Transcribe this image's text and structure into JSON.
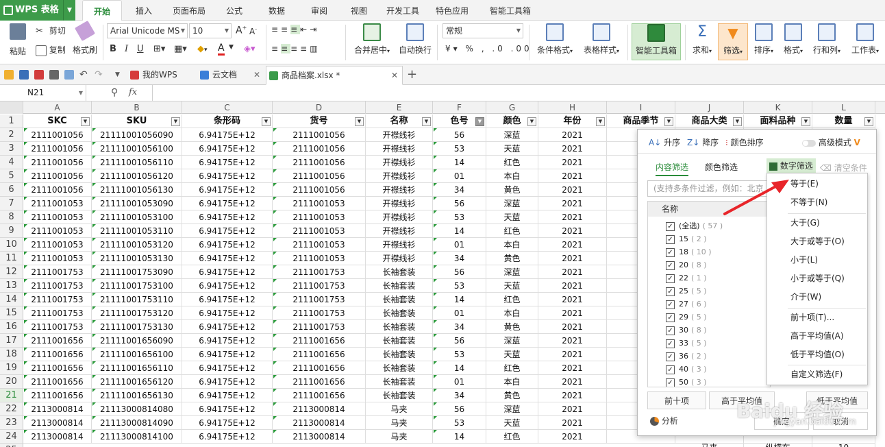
{
  "menubar": {
    "app_button": "WPS 表格",
    "tabs": [
      "开始",
      "插入",
      "页面布局",
      "公式",
      "数据",
      "审阅",
      "视图",
      "开发工具",
      "特色应用",
      "智能工具箱"
    ],
    "active_tab": "开始"
  },
  "ribbon": {
    "paste": "粘贴",
    "cut": "剪切",
    "copy": "复制",
    "format_painter": "格式刷",
    "font_name": "Arial Unicode MS",
    "font_size": "10",
    "number_format": "常规",
    "merge_center": "合并居中",
    "wrap_text": "自动换行",
    "cond_format": "条件格式",
    "table_style": "表格样式",
    "smart_toolbox": "智能工具箱",
    "sum": "求和",
    "filter": "筛选",
    "sort": "排序",
    "format": "格式",
    "row_col": "行和列",
    "worksheet": "工作表"
  },
  "doc_tabs": [
    {
      "label": "我的WPS"
    },
    {
      "label": "云文档"
    },
    {
      "label": "商品档案.xlsx *"
    }
  ],
  "formula_bar": {
    "cell_ref": "N21",
    "fx": "fx"
  },
  "sheet": {
    "columns": [
      "A",
      "B",
      "C",
      "D",
      "E",
      "F",
      "G",
      "H",
      "I",
      "J",
      "K",
      "L"
    ],
    "headers": [
      "SKC",
      "SKU",
      "条形码",
      "货号",
      "名称",
      "色号",
      "颜色",
      "年份",
      "商品季节",
      "商品大类",
      "面料品种",
      "数量"
    ],
    "rows": [
      [
        "2111001056",
        "21111001056090",
        "6.94175E+12",
        "2111001056",
        "开襟线衫",
        "56",
        "深蓝",
        "2021"
      ],
      [
        "2111001056",
        "21111001056100",
        "6.94175E+12",
        "2111001056",
        "开襟线衫",
        "53",
        "天蓝",
        "2021"
      ],
      [
        "2111001056",
        "21111001056110",
        "6.94175E+12",
        "2111001056",
        "开襟线衫",
        "14",
        "红色",
        "2021"
      ],
      [
        "2111001056",
        "21111001056120",
        "6.94175E+12",
        "2111001056",
        "开襟线衫",
        "01",
        "本白",
        "2021"
      ],
      [
        "2111001056",
        "21111001056130",
        "6.94175E+12",
        "2111001056",
        "开襟线衫",
        "34",
        "黄色",
        "2021"
      ],
      [
        "2111001053",
        "21111001053090",
        "6.94175E+12",
        "2111001053",
        "开襟线衫",
        "56",
        "深蓝",
        "2021"
      ],
      [
        "2111001053",
        "21111001053100",
        "6.94175E+12",
        "2111001053",
        "开襟线衫",
        "53",
        "天蓝",
        "2021"
      ],
      [
        "2111001053",
        "21111001053110",
        "6.94175E+12",
        "2111001053",
        "开襟线衫",
        "14",
        "红色",
        "2021"
      ],
      [
        "2111001053",
        "21111001053120",
        "6.94175E+12",
        "2111001053",
        "开襟线衫",
        "01",
        "本白",
        "2021"
      ],
      [
        "2111001053",
        "21111001053130",
        "6.94175E+12",
        "2111001053",
        "开襟线衫",
        "34",
        "黄色",
        "2021"
      ],
      [
        "2111001753",
        "21111001753090",
        "6.94175E+12",
        "2111001753",
        "长袖套装",
        "56",
        "深蓝",
        "2021"
      ],
      [
        "2111001753",
        "21111001753100",
        "6.94175E+12",
        "2111001753",
        "长袖套装",
        "53",
        "天蓝",
        "2021"
      ],
      [
        "2111001753",
        "21111001753110",
        "6.94175E+12",
        "2111001753",
        "长袖套装",
        "14",
        "红色",
        "2021"
      ],
      [
        "2111001753",
        "21111001753120",
        "6.94175E+12",
        "2111001753",
        "长袖套装",
        "01",
        "本白",
        "2021"
      ],
      [
        "2111001753",
        "21111001753130",
        "6.94175E+12",
        "2111001753",
        "长袖套装",
        "34",
        "黄色",
        "2021"
      ],
      [
        "2111001656",
        "21111001656090",
        "6.94175E+12",
        "2111001656",
        "长袖套装",
        "56",
        "深蓝",
        "2021"
      ],
      [
        "2111001656",
        "21111001656100",
        "6.94175E+12",
        "2111001656",
        "长袖套装",
        "53",
        "天蓝",
        "2021"
      ],
      [
        "2111001656",
        "21111001656110",
        "6.94175E+12",
        "2111001656",
        "长袖套装",
        "14",
        "红色",
        "2021"
      ],
      [
        "2111001656",
        "21111001656120",
        "6.94175E+12",
        "2111001656",
        "长袖套装",
        "01",
        "本白",
        "2021"
      ],
      [
        "2111001656",
        "21111001656130",
        "6.94175E+12",
        "2111001656",
        "长袖套装",
        "34",
        "黄色",
        "2021"
      ],
      [
        "2113000814",
        "21113000814080",
        "6.94175E+12",
        "2113000814",
        "马夹",
        "56",
        "深蓝",
        "2021"
      ],
      [
        "2113000814",
        "21113000814090",
        "6.94175E+12",
        "2113000814",
        "马夹",
        "53",
        "天蓝",
        "2021"
      ],
      [
        "2113000814",
        "21113000814100",
        "6.94175E+12",
        "2113000814",
        "马夹",
        "14",
        "红色",
        "2021"
      ]
    ],
    "selected_row": "21",
    "partial_row_behind_panel": {
      "J": "马夹",
      "K": "纵横布",
      "L": "10"
    }
  },
  "filter_panel": {
    "sort_asc": "升序",
    "sort_desc": "降序",
    "color_sort": "颜色排序",
    "advanced_mode": "高级模式",
    "tab_content": "内容筛选",
    "tab_color": "颜色筛选",
    "tab_number": "数字筛选",
    "clear": "清空条件",
    "search_placeholder": "(支持多条件过滤，例如：北京 上海)",
    "list_header": "名称",
    "items": [
      {
        "label": "(全选)",
        "count": "( 57 )"
      },
      {
        "label": "15",
        "count": "( 2 )"
      },
      {
        "label": "18",
        "count": "( 10 )"
      },
      {
        "label": "20",
        "count": "( 8 )"
      },
      {
        "label": "22",
        "count": "( 1 )"
      },
      {
        "label": "25",
        "count": "( 5 )"
      },
      {
        "label": "27",
        "count": "( 6 )"
      },
      {
        "label": "29",
        "count": "( 5 )"
      },
      {
        "label": "30",
        "count": "( 8 )"
      },
      {
        "label": "33",
        "count": "( 5 )"
      },
      {
        "label": "36",
        "count": "( 2 )"
      },
      {
        "label": "40",
        "count": "( 3 )"
      },
      {
        "label": "50",
        "count": "( 3 )"
      }
    ],
    "btn_top10": "前十项",
    "btn_above_avg": "高于平均值",
    "btn_below_avg": "低于平均值",
    "analysis": "分析",
    "ok": "确定",
    "cancel": "取消"
  },
  "number_filter_menu": [
    "等于(E)",
    "不等于(N)",
    "大于(G)",
    "大于或等于(O)",
    "小于(L)",
    "小于或等于(Q)",
    "介于(W)",
    "前十项(T)...",
    "高于平均值(A)",
    "低于平均值(O)",
    "自定义筛选(F)"
  ],
  "watermark": {
    "text": "Baidu 经验",
    "sub": "jingyan.baidu.com"
  },
  "colors": {
    "accent": "#2a8c3a",
    "arrow": "#e8252a"
  }
}
